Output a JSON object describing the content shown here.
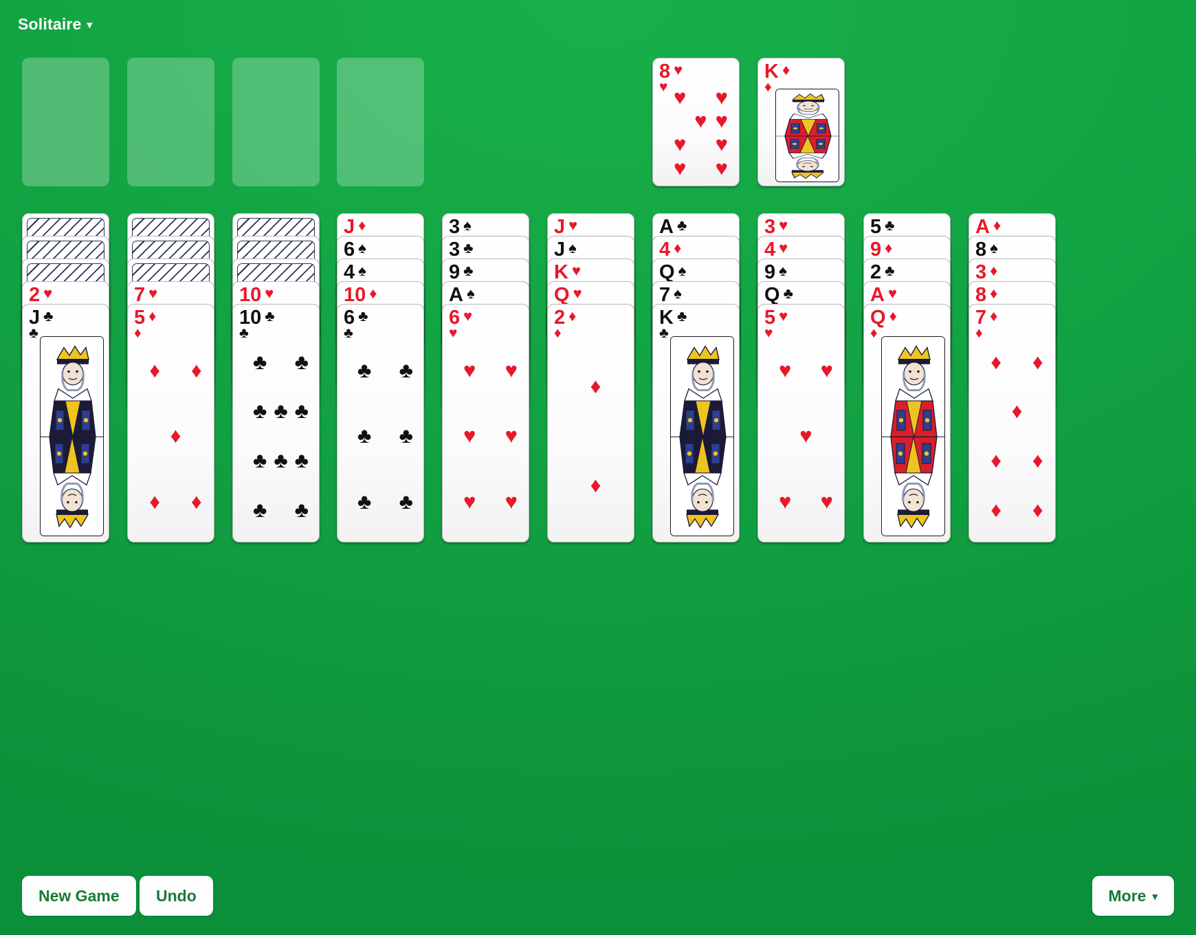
{
  "app": {
    "title": "Solitaire",
    "title_caret": "▾"
  },
  "colors": {
    "felt_green": "#13a544",
    "red_suit": "#e8182a",
    "black_suit": "#111111",
    "button_text": "#1a7a36",
    "button_bg": "#fdfdfd",
    "slot_fill": "rgba(255,255,255,0.26)"
  },
  "foundations": [
    {
      "name": "foundation-slot-1",
      "empty": true
    },
    {
      "name": "foundation-slot-2",
      "empty": true
    },
    {
      "name": "foundation-slot-3",
      "empty": true
    },
    {
      "name": "foundation-slot-4",
      "empty": true
    }
  ],
  "waste": [
    {
      "rank": "8",
      "suit": "♥",
      "suit_name": "hearts",
      "color": "red",
      "face": "pip",
      "pips": 8
    },
    {
      "rank": "K",
      "suit": "♦",
      "suit_name": "diamonds",
      "color": "red",
      "face": "court",
      "court": "king"
    }
  ],
  "tableau": [
    {
      "name": "tableau-column-1",
      "cards": [
        {
          "facedown": true
        },
        {
          "facedown": true
        },
        {
          "facedown": true
        },
        {
          "rank": "2",
          "suit": "♥",
          "suit_name": "hearts",
          "color": "red",
          "face": "pip",
          "pips": 2
        },
        {
          "rank": "J",
          "suit": "♣",
          "suit_name": "clubs",
          "color": "black",
          "face": "court",
          "court": "jack"
        }
      ]
    },
    {
      "name": "tableau-column-2",
      "cards": [
        {
          "facedown": true
        },
        {
          "facedown": true
        },
        {
          "facedown": true
        },
        {
          "rank": "7",
          "suit": "♥",
          "suit_name": "hearts",
          "color": "red",
          "face": "pip",
          "pips": 7
        },
        {
          "rank": "5",
          "suit": "♦",
          "suit_name": "diamonds",
          "color": "red",
          "face": "pip",
          "pips": 5
        }
      ]
    },
    {
      "name": "tableau-column-3",
      "cards": [
        {
          "facedown": true
        },
        {
          "facedown": true
        },
        {
          "facedown": true
        },
        {
          "rank": "10",
          "suit": "♥",
          "suit_name": "hearts",
          "color": "red",
          "face": "pip",
          "pips": 10
        },
        {
          "rank": "10",
          "suit": "♣",
          "suit_name": "clubs",
          "color": "black",
          "face": "pip",
          "pips": 10
        }
      ]
    },
    {
      "name": "tableau-column-4",
      "cards": [
        {
          "rank": "J",
          "suit": "♦",
          "suit_name": "diamonds",
          "color": "red",
          "face": "pip",
          "pips": 0
        },
        {
          "rank": "6",
          "suit": "♠",
          "suit_name": "spades",
          "color": "black",
          "face": "pip",
          "pips": 6
        },
        {
          "rank": "4",
          "suit": "♠",
          "suit_name": "spades",
          "color": "black",
          "face": "pip",
          "pips": 4
        },
        {
          "rank": "10",
          "suit": "♦",
          "suit_name": "diamonds",
          "color": "red",
          "face": "pip",
          "pips": 10
        },
        {
          "rank": "6",
          "suit": "♣",
          "suit_name": "clubs",
          "color": "black",
          "face": "pip",
          "pips": 6
        }
      ]
    },
    {
      "name": "tableau-column-5",
      "cards": [
        {
          "rank": "3",
          "suit": "♠",
          "suit_name": "spades",
          "color": "black",
          "face": "pip",
          "pips": 3
        },
        {
          "rank": "3",
          "suit": "♣",
          "suit_name": "clubs",
          "color": "black",
          "face": "pip",
          "pips": 3
        },
        {
          "rank": "9",
          "suit": "♣",
          "suit_name": "clubs",
          "color": "black",
          "face": "pip",
          "pips": 9
        },
        {
          "rank": "A",
          "suit": "♠",
          "suit_name": "spades",
          "color": "black",
          "face": "pip",
          "pips": 1
        },
        {
          "rank": "6",
          "suit": "♥",
          "suit_name": "hearts",
          "color": "red",
          "face": "pip",
          "pips": 6
        }
      ]
    },
    {
      "name": "tableau-column-6",
      "cards": [
        {
          "rank": "J",
          "suit": "♥",
          "suit_name": "hearts",
          "color": "red",
          "face": "pip",
          "pips": 0
        },
        {
          "rank": "J",
          "suit": "♠",
          "suit_name": "spades",
          "color": "black",
          "face": "pip",
          "pips": 0
        },
        {
          "rank": "K",
          "suit": "♥",
          "suit_name": "hearts",
          "color": "red",
          "face": "pip",
          "pips": 0
        },
        {
          "rank": "Q",
          "suit": "♥",
          "suit_name": "hearts",
          "color": "red",
          "face": "pip",
          "pips": 0
        },
        {
          "rank": "2",
          "suit": "♦",
          "suit_name": "diamonds",
          "color": "red",
          "face": "pip",
          "pips": 2
        }
      ]
    },
    {
      "name": "tableau-column-7",
      "cards": [
        {
          "rank": "A",
          "suit": "♣",
          "suit_name": "clubs",
          "color": "black",
          "face": "pip",
          "pips": 1
        },
        {
          "rank": "4",
          "suit": "♦",
          "suit_name": "diamonds",
          "color": "red",
          "face": "pip",
          "pips": 4
        },
        {
          "rank": "Q",
          "suit": "♠",
          "suit_name": "spades",
          "color": "black",
          "face": "pip",
          "pips": 0
        },
        {
          "rank": "7",
          "suit": "♠",
          "suit_name": "spades",
          "color": "black",
          "face": "pip",
          "pips": 7
        },
        {
          "rank": "K",
          "suit": "♣",
          "suit_name": "clubs",
          "color": "black",
          "face": "court",
          "court": "king"
        }
      ]
    },
    {
      "name": "tableau-column-8",
      "cards": [
        {
          "rank": "3",
          "suit": "♥",
          "suit_name": "hearts",
          "color": "red",
          "face": "pip",
          "pips": 3
        },
        {
          "rank": "4",
          "suit": "♥",
          "suit_name": "hearts",
          "color": "red",
          "face": "pip",
          "pips": 4
        },
        {
          "rank": "9",
          "suit": "♠",
          "suit_name": "spades",
          "color": "black",
          "face": "pip",
          "pips": 9
        },
        {
          "rank": "Q",
          "suit": "♣",
          "suit_name": "clubs",
          "color": "black",
          "face": "pip",
          "pips": 0
        },
        {
          "rank": "5",
          "suit": "♥",
          "suit_name": "hearts",
          "color": "red",
          "face": "pip",
          "pips": 5
        }
      ]
    },
    {
      "name": "tableau-column-9",
      "cards": [
        {
          "rank": "5",
          "suit": "♣",
          "suit_name": "clubs",
          "color": "black",
          "face": "pip",
          "pips": 5
        },
        {
          "rank": "9",
          "suit": "♦",
          "suit_name": "diamonds",
          "color": "red",
          "face": "pip",
          "pips": 9
        },
        {
          "rank": "2",
          "suit": "♣",
          "suit_name": "clubs",
          "color": "black",
          "face": "pip",
          "pips": 2
        },
        {
          "rank": "A",
          "suit": "♥",
          "suit_name": "hearts",
          "color": "red",
          "face": "pip",
          "pips": 1
        },
        {
          "rank": "Q",
          "suit": "♦",
          "suit_name": "diamonds",
          "color": "red",
          "face": "court",
          "court": "queen"
        }
      ]
    },
    {
      "name": "tableau-column-10",
      "cards": [
        {
          "rank": "A",
          "suit": "♦",
          "suit_name": "diamonds",
          "color": "red",
          "face": "pip",
          "pips": 1
        },
        {
          "rank": "8",
          "suit": "♠",
          "suit_name": "spades",
          "color": "black",
          "face": "pip",
          "pips": 8
        },
        {
          "rank": "3",
          "suit": "♦",
          "suit_name": "diamonds",
          "color": "red",
          "face": "pip",
          "pips": 3
        },
        {
          "rank": "8",
          "suit": "♦",
          "suit_name": "diamonds",
          "color": "red",
          "face": "pip",
          "pips": 8
        },
        {
          "rank": "7",
          "suit": "♦",
          "suit_name": "diamonds",
          "color": "red",
          "face": "pip",
          "pips": 7
        }
      ]
    }
  ],
  "toolbar": {
    "new_game_label": "New Game",
    "undo_label": "Undo",
    "more_label": "More",
    "more_caret": "▾"
  }
}
